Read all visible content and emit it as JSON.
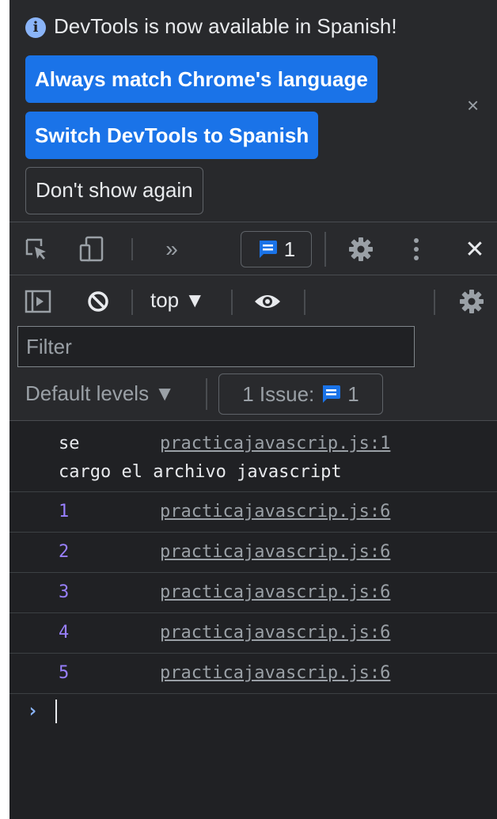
{
  "infobar": {
    "message": "DevTools is now available in Spanish!",
    "info_icon": "info-icon",
    "buttons": {
      "match_language": "Always match Chrome's language",
      "switch_spanish": "Switch DevTools to Spanish",
      "dont_show": "Don't show again"
    },
    "close_glyph": "×"
  },
  "toolbar": {
    "more_tabs_glyph": "»",
    "issues_count": "1",
    "close_glyph": "✕"
  },
  "console_toolbar": {
    "context": "top ▼",
    "filter_placeholder": "Filter",
    "levels": "Default levels ▼",
    "issues_label": "1 Issue:",
    "issues_count": "1"
  },
  "messages": [
    {
      "text_line1": "se",
      "text_line2": "cargo el archivo javascript",
      "source": "practicajavascrip.js:1"
    },
    {
      "value": "1",
      "source": "practicajavascrip.js:6"
    },
    {
      "value": "2",
      "source": "practicajavascrip.js:6"
    },
    {
      "value": "3",
      "source": "practicajavascrip.js:6"
    },
    {
      "value": "4",
      "source": "practicajavascrip.js:6"
    },
    {
      "value": "5",
      "source": "practicajavascrip.js:6"
    }
  ],
  "prompt": {
    "caret": "›"
  },
  "colors": {
    "accent": "#1a73e8",
    "number": "#9980ff",
    "link": "#9aa0a6",
    "background": "#202124"
  }
}
